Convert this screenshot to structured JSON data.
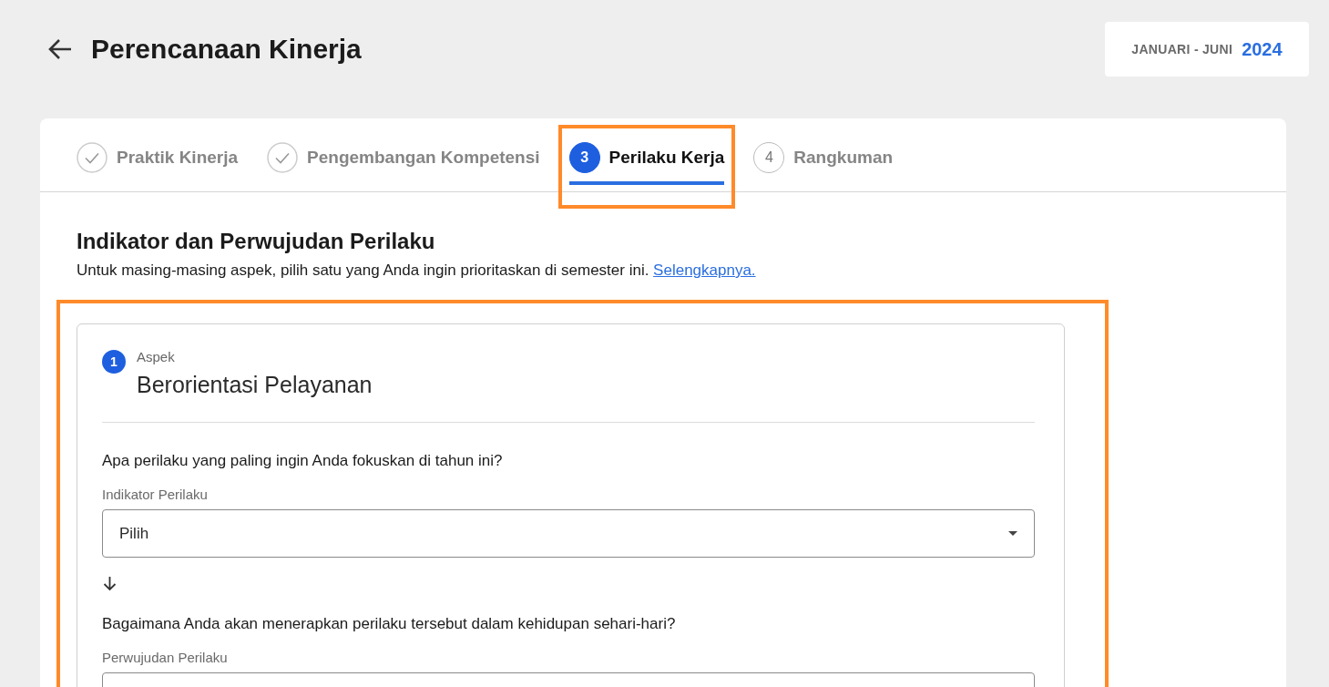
{
  "header": {
    "title": "Perencanaan Kinerja",
    "period": {
      "label": "JANUARI - JUNI",
      "year": "2024"
    }
  },
  "steps": [
    {
      "kind": "done",
      "label": "Praktik Kinerja",
      "selected": false,
      "highlighted": false
    },
    {
      "kind": "done",
      "label": "Pengembangan Kompetensi",
      "selected": false,
      "highlighted": false
    },
    {
      "kind": "number",
      "marker": "3",
      "label": "Perilaku Kerja",
      "selected": true,
      "highlighted": true
    },
    {
      "kind": "number",
      "marker": "4",
      "label": "Rangkuman",
      "selected": false,
      "highlighted": false
    }
  ],
  "section": {
    "title": "Indikator dan Perwujudan Perilaku",
    "description": "Untuk masing-masing aspek, pilih satu yang Anda ingin prioritaskan di semester ini.",
    "link": "Selengkapnya."
  },
  "aspects": [
    {
      "number": "1",
      "caption": "Aspek",
      "title": "Berorientasi Pelayanan",
      "highlighted": true,
      "fields": [
        {
          "kind": "select",
          "question": "Apa perilaku yang paling ingin Anda fokuskan di tahun ini?",
          "label": "Indikator Perilaku",
          "value": "Pilih"
        },
        {
          "kind": "cut",
          "question": "Bagaimana Anda akan menerapkan perilaku tersebut dalam kehidupan sehari-hari?",
          "label": "Perwujudan Perilaku"
        }
      ]
    }
  ]
}
